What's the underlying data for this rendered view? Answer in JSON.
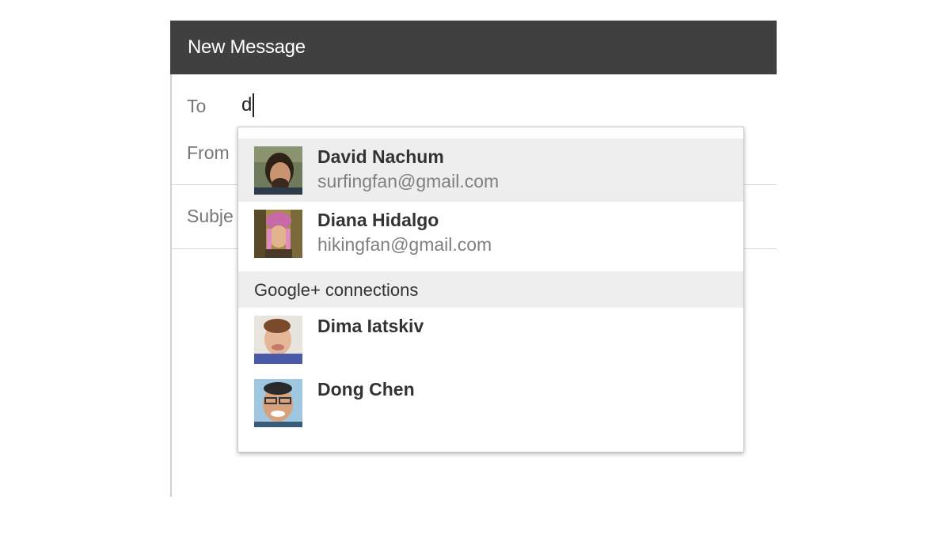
{
  "compose": {
    "title": "New Message",
    "to_label": "To",
    "to_value": "d",
    "from_label": "From",
    "subject_label": "Subje"
  },
  "suggestions": {
    "contacts": [
      {
        "name": "David Nachum",
        "email": "surfingfan@gmail.com",
        "selected": true
      },
      {
        "name": "Diana Hidalgo",
        "email": "hikingfan@gmail.com",
        "selected": false
      }
    ],
    "section_label": "Google+ connections",
    "connections": [
      {
        "name": "Dima Iatskiv"
      },
      {
        "name": "Dong Chen"
      }
    ]
  },
  "colors": {
    "header_bg": "#404040",
    "selected_bg": "#eeeeee"
  }
}
